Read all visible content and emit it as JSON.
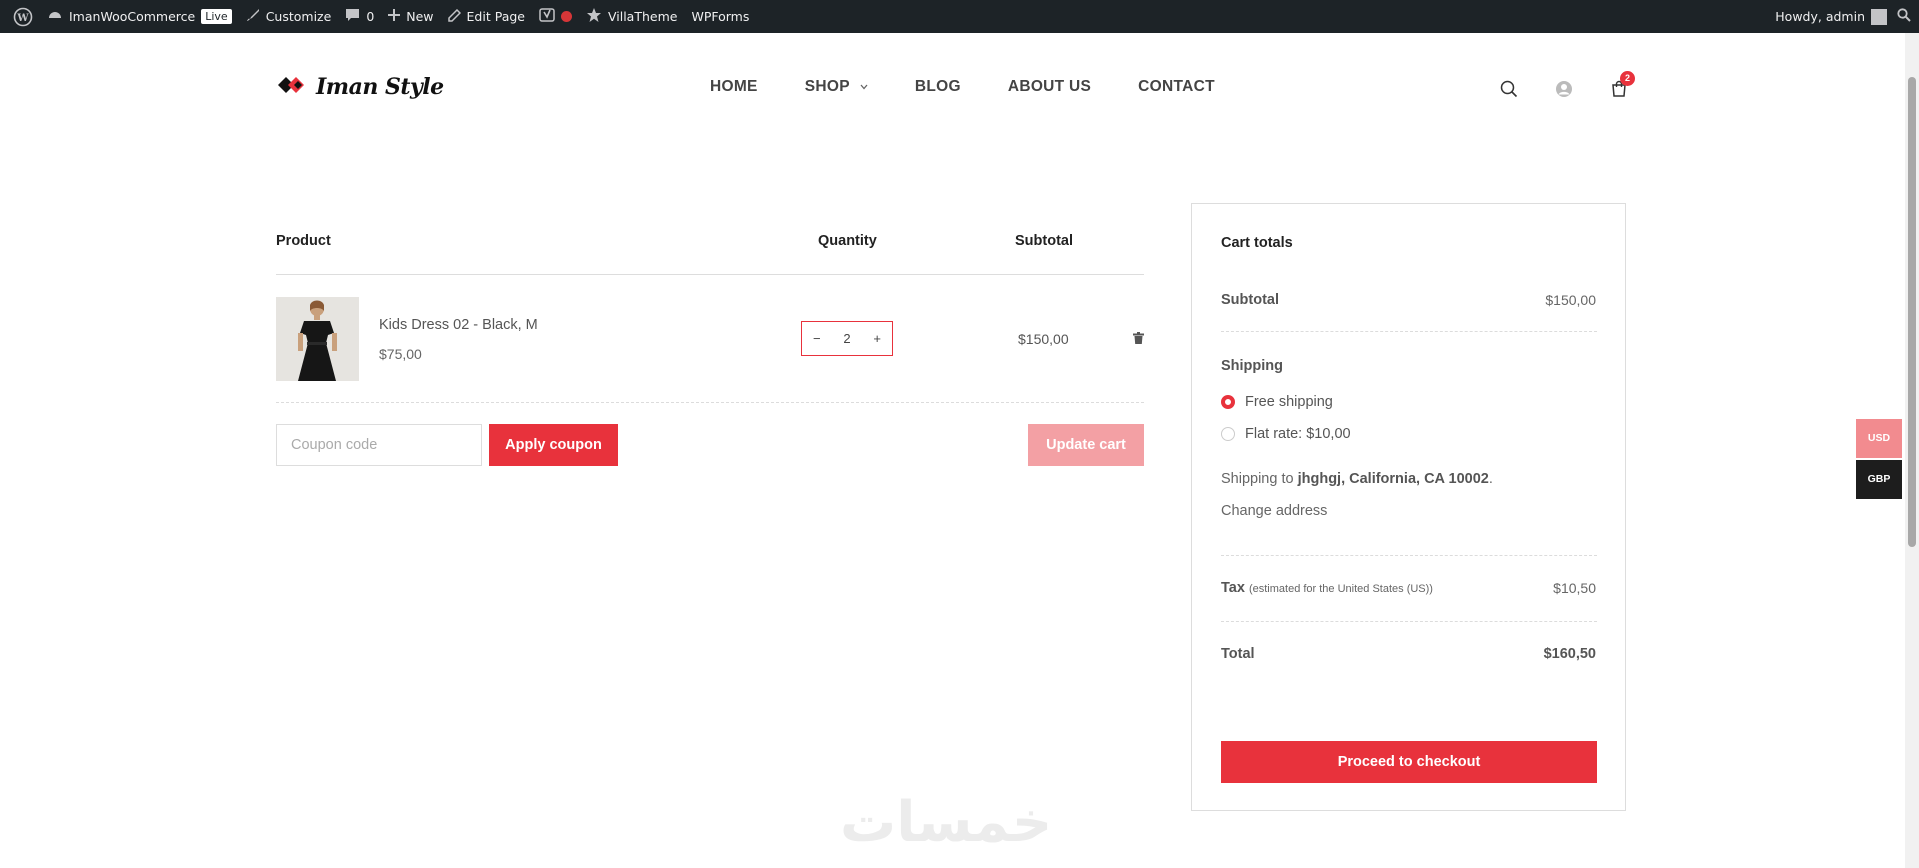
{
  "admin_bar": {
    "site_name": "ImanWooCommerce",
    "live_badge": "Live",
    "customize": "Customize",
    "comments_count": "0",
    "new": "New",
    "edit_page": "Edit Page",
    "villatheme": "VillaTheme",
    "wpforms": "WPForms",
    "howdy": "Howdy, admin"
  },
  "header": {
    "logo_text": "Iman Style",
    "nav": [
      "HOME",
      "SHOP",
      "BLOG",
      "ABOUT US",
      "CONTACT"
    ],
    "cart_count": "2"
  },
  "cart": {
    "col_product": "Product",
    "col_quantity": "Quantity",
    "col_subtotal": "Subtotal",
    "item": {
      "name": "Kids Dress 02 - Black, M",
      "price": "$75,00",
      "quantity": "2",
      "qty_minus": "−",
      "qty_plus": "+",
      "subtotal": "$150,00"
    },
    "coupon_placeholder": "Coupon code",
    "apply_coupon": "Apply coupon",
    "update_cart": "Update cart"
  },
  "totals": {
    "title": "Cart totals",
    "subtotal_label": "Subtotal",
    "subtotal_value": "$150,00",
    "shipping_label": "Shipping",
    "option_free": "Free shipping",
    "option_flat": "Flat rate: $10,00",
    "shipping_to_prefix": "Shipping to",
    "shipping_to_address": "jhghgj, California, CA 10002",
    "shipping_to_suffix": ".",
    "change_address": "Change address",
    "tax_label": "Tax",
    "tax_note": "(estimated for the United States (US))",
    "tax_value": "$10,50",
    "total_label": "Total",
    "total_value": "$160,50",
    "checkout": "Proceed to checkout"
  },
  "currency": {
    "usd": "USD",
    "gbp": "GBP"
  },
  "watermark": "خمسات",
  "colors": {
    "accent": "#e8323c",
    "accent_light": "#f3a0a4",
    "admin_bar": "#1d2327"
  }
}
